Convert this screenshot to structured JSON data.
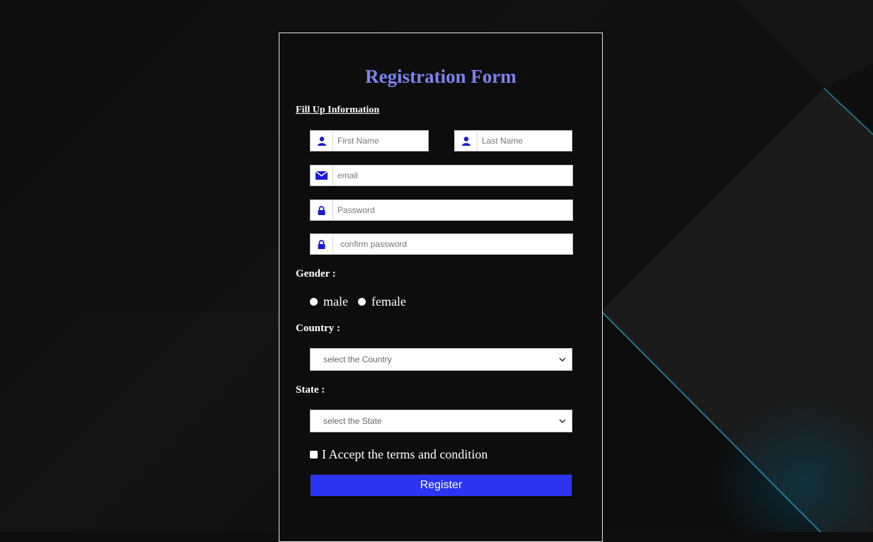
{
  "form": {
    "title": "Registration Form",
    "subtitle": "Fill Up Information",
    "first_name_placeholder": "First Name",
    "last_name_placeholder": "Last Name",
    "email_placeholder": "email",
    "password_placeholder": "Password",
    "confirm_password_placeholder": "confirm password",
    "gender_label": "Gender :",
    "gender_options": [
      "male",
      "female"
    ],
    "country_label": "Country :",
    "country_selected": "select the Country",
    "state_label": "State :",
    "state_selected": "select the State",
    "terms_label": "I Accept the terms and condition",
    "register_label": "Register"
  },
  "icons": {
    "first_name": "user-icon",
    "last_name": "user-icon",
    "email": "envelope-icon",
    "password": "lock-icon",
    "confirm_password": "lock-icon",
    "select_chevron": "chevron-down-icon"
  },
  "colors": {
    "title": "#7b84ee",
    "icon": "#1a1ad6",
    "button": "#2b34f0",
    "panel_border": "#e6e6e6",
    "background": "#0e0e0e"
  }
}
